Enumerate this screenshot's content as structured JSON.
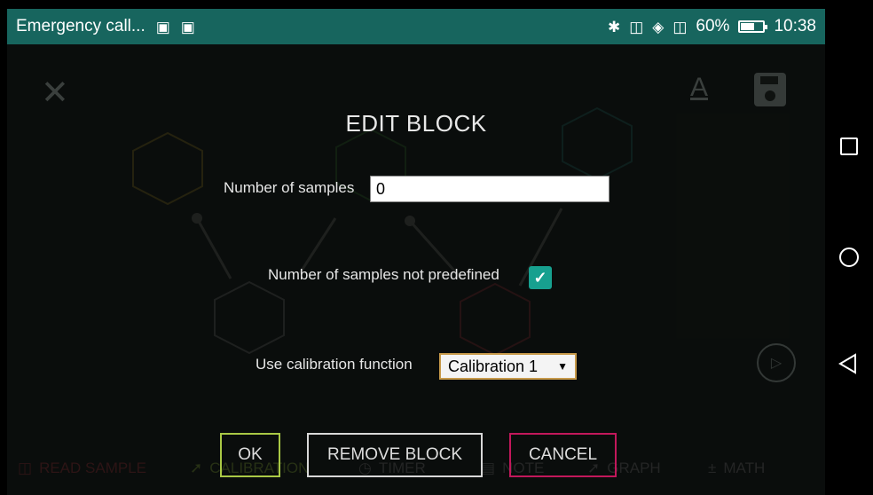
{
  "status_bar": {
    "title": "Emergency call...",
    "battery_percent": "60%",
    "battery_level": 0.6,
    "time": "10:38",
    "icons": [
      "gallery-icon",
      "briefcase-icon",
      "bluetooth-icon",
      "nfc-icon",
      "wifi-icon",
      "vibrate-icon",
      "battery-icon"
    ]
  },
  "toolbar": {
    "close_icon": "close-icon",
    "font_icon": "font-icon",
    "save_icon": "save-icon",
    "font_glyph": "A"
  },
  "dialog": {
    "title": "EDIT BLOCK",
    "samples_label": "Number of samples",
    "samples_value": "0",
    "not_predefined_label": "Number of samples not predefined",
    "not_predefined_checked": true,
    "calibration_label": "Use calibration function",
    "calibration_value": "Calibration 1",
    "ok_label": "OK",
    "remove_label": "REMOVE BLOCK",
    "cancel_label": "CANCEL"
  },
  "bottom_tools": [
    {
      "label": "READ SAMPLE",
      "color": "#4a1b1e"
    },
    {
      "label": "CALIBRATION",
      "color": "#2f3a17"
    },
    {
      "label": "TIMER",
      "color": "#2d2d2d"
    },
    {
      "label": "NOTE",
      "color": "#2d2d2d"
    },
    {
      "label": "GRAPH",
      "color": "#2d2d2d"
    },
    {
      "label": "MATH",
      "color": "#2d2d2d"
    }
  ],
  "colors": {
    "status_bar": "#17655e",
    "checkbox": "#17a08f",
    "ok_border": "#a9c845",
    "cancel_border": "#c2185b",
    "select_border": "#c79a4a"
  }
}
